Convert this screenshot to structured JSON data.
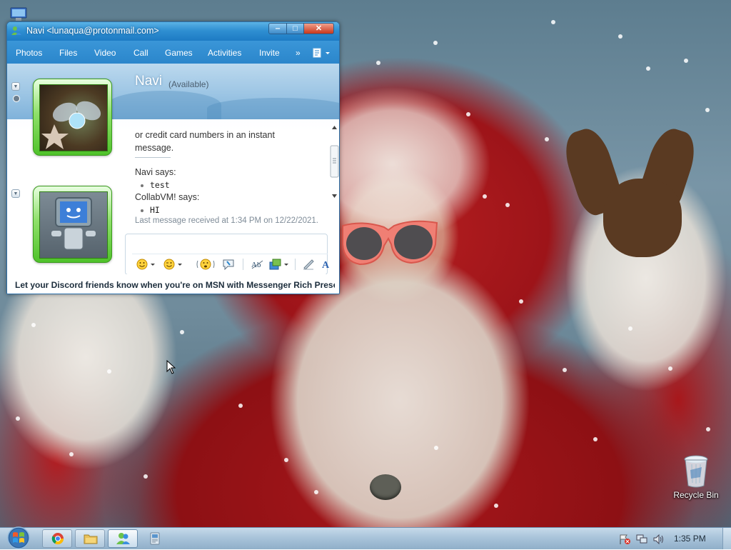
{
  "window": {
    "title": "Navi <lunaqua@protonmail.com>",
    "minimize_label": "‒",
    "maximize_label": "□",
    "close_label": "✕"
  },
  "menu": {
    "items": [
      "Photos",
      "Files",
      "Video",
      "Call",
      "Games",
      "Activities",
      "Invite"
    ],
    "more_label": "»"
  },
  "contact": {
    "name": "Navi",
    "status": "(Available)"
  },
  "chat": {
    "lines": [
      "or credit card numbers in an instant",
      "message."
    ],
    "messages": [
      {
        "sender": "Navi says:",
        "text": "test"
      },
      {
        "sender": "CollabVM! says:",
        "text": "HI"
      }
    ],
    "last_received": "Last message received at 1:34 PM on 12/22/2021."
  },
  "input": {
    "toolbar_icons": [
      "emoticon-icon",
      "wink-icon",
      "nudge-icon",
      "voice-clip-icon",
      "font-icon",
      "background-icon",
      "handwriting-icon",
      "text-color-icon"
    ]
  },
  "ad": {
    "text": "Let your Discord friends know when you're on MSN with Messenger Rich Presence"
  },
  "desktop": {
    "recycle_bin_label": "Recycle Bin"
  },
  "taskbar": {
    "clock": "1:35 PM",
    "apps": [
      "chrome-icon",
      "file-explorer-icon",
      "msn-messenger-icon"
    ],
    "accent": "#2f8fd2"
  }
}
